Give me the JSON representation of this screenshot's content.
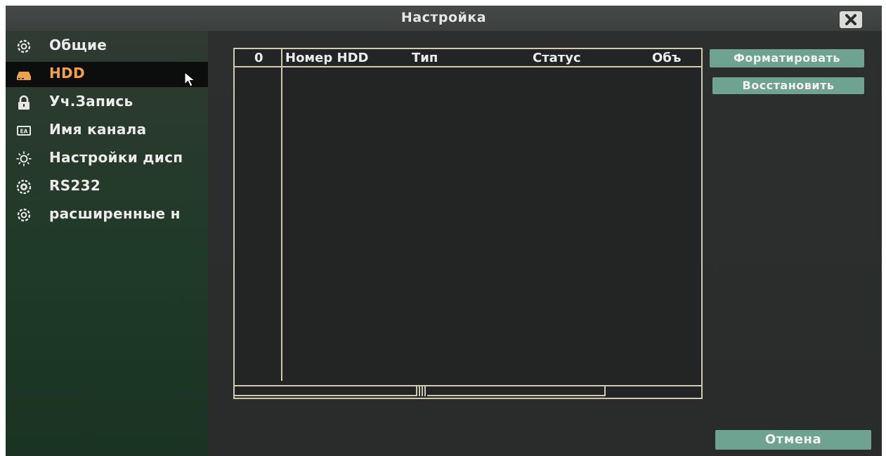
{
  "window": {
    "title": "Настройка",
    "close_icon": "close-icon"
  },
  "sidebar": {
    "items": [
      {
        "label": "Общие",
        "icon": "gear-icon",
        "active": false
      },
      {
        "label": "HDD",
        "icon": "hdd-icon",
        "active": true
      },
      {
        "label": "Уч.Запись",
        "icon": "lock-icon",
        "active": false
      },
      {
        "label": "Имя канала",
        "icon": "channel-name-icon",
        "active": false
      },
      {
        "label": "Настройки дисп",
        "icon": "sun-icon",
        "active": false
      },
      {
        "label": "RS232",
        "icon": "rs232-icon",
        "active": false
      },
      {
        "label": "расширенные н",
        "icon": "gear-icon",
        "active": false
      }
    ]
  },
  "hdd_table": {
    "columns": [
      "0",
      "Номер HDD",
      "Тип",
      "Статус",
      "Объ"
    ],
    "rows": []
  },
  "buttons": {
    "format": "Форматировать",
    "restore": "Восстановить",
    "cancel": "Отмена"
  },
  "colors": {
    "active_label": "#f0a24a",
    "button_bg": "#6fa391",
    "table_border": "#cfcab0"
  }
}
